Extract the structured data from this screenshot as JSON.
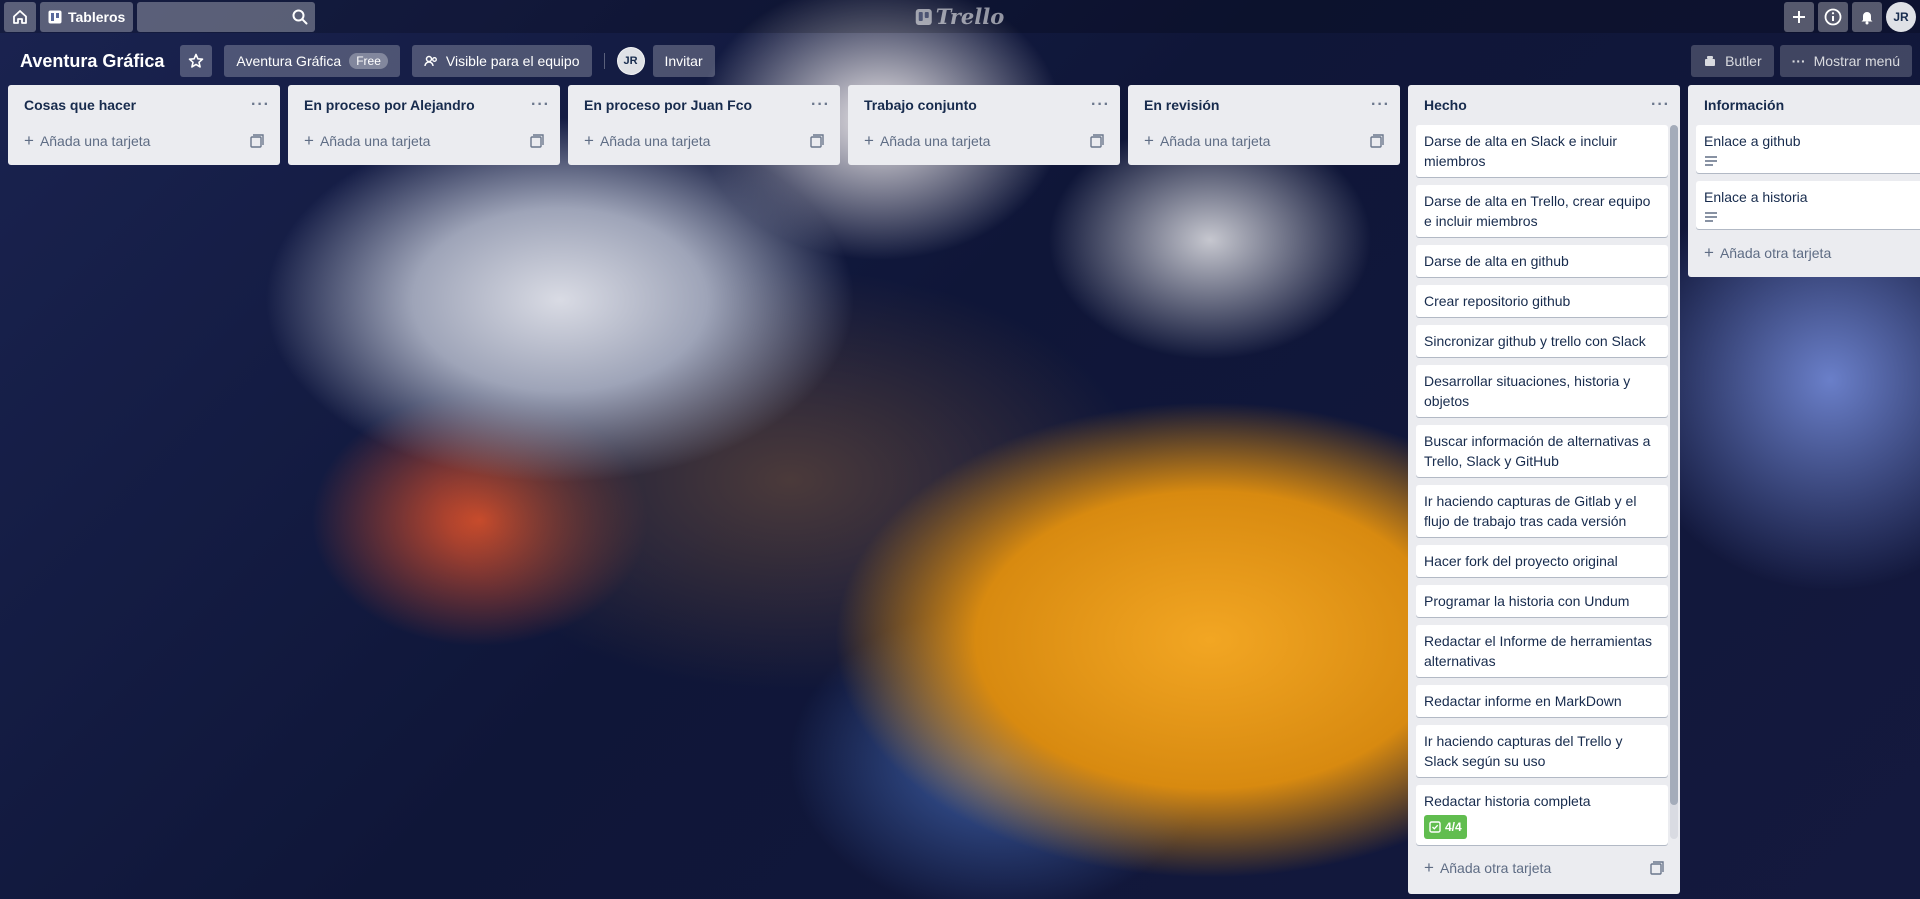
{
  "topbar": {
    "boards_label": "Tableros",
    "search_placeholder": "",
    "logo_text": "Trello",
    "user_initials": "JR"
  },
  "board": {
    "title": "Aventura Gráfica",
    "team_label": "Aventura Gráfica",
    "team_badge": "Free",
    "visibility_label": "Visible para el equipo",
    "member_initials": "JR",
    "invite_label": "Invitar",
    "butler_label": "Butler",
    "menu_label": "Mostrar menú"
  },
  "lists": [
    {
      "title": "Cosas que hacer",
      "add_label": "Añada una tarjeta"
    },
    {
      "title": "En proceso por Alejandro",
      "add_label": "Añada una tarjeta"
    },
    {
      "title": "En proceso por Juan Fco",
      "add_label": "Añada una tarjeta"
    },
    {
      "title": "Trabajo conjunto",
      "add_label": "Añada una tarjeta"
    },
    {
      "title": "En revisión",
      "add_label": "Añada una tarjeta"
    },
    {
      "title": "Hecho",
      "add_label": "Añada otra tarjeta",
      "cards": [
        "Darse de alta en Slack e incluir miembros",
        "Darse de alta en Trello, crear equipo e incluir miembros",
        "Darse de alta en github",
        "Crear repositorio github",
        "Sincronizar github y trello con Slack",
        "Desarrollar situaciones, historia y objetos",
        "Buscar información de alternativas a Trello, Slack y GitHub",
        "Ir haciendo capturas de Gitlab y el flujo de trabajo tras cada versión",
        "Hacer fork del proyecto original",
        "Programar la historia con Undum",
        "Redactar el Informe de herramientas alternativas",
        "Redactar informe en MarkDown",
        "Ir haciendo capturas del Trello y Slack según su uso",
        "Redactar historia completa"
      ],
      "last_card_checklist": "4/4"
    },
    {
      "title": "Información",
      "add_label": "Añada otra tarjeta",
      "cards": [
        "Enlace a github",
        "Enlace a historia"
      ]
    }
  ],
  "colors": {
    "checklist_complete": "#61bd4f",
    "list_bg": "#ebecf0"
  }
}
